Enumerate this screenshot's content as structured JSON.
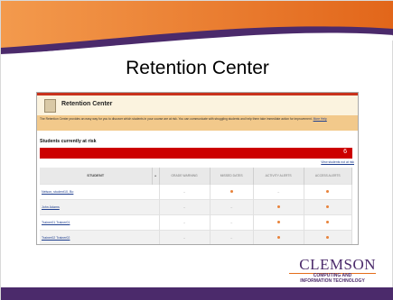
{
  "slide": {
    "title": "Retention Center",
    "colors": {
      "purple": "#4b2a6b",
      "orange": "#e46d1a",
      "red": "#cc0000"
    }
  },
  "screenshot": {
    "header_title": "Retention Center",
    "info_text": "The Retention Center provides an easy way for you to discover which students in your course are at risk. You can communicate with struggling students and help them take immediate action for improvement. ",
    "info_link": "More Help",
    "students_heading": "Students currently at risk",
    "at_risk_count": "6",
    "view_link": "View students not at risk",
    "columns": [
      "STUDENT",
      "GRADE WARNING",
      "MISSED DATES",
      "ACTIVITY ALERTS",
      "ACCESS ALERTS"
    ],
    "rows": [
      {
        "name": "Nelson, student10, Bo",
        "cells": [
          "–",
          "●",
          "–",
          "●"
        ]
      },
      {
        "name": "John Adams",
        "cells": [
          "–",
          "–",
          "●",
          "●"
        ]
      },
      {
        "name": "Trainer01 Trainer01",
        "cells": [
          "–",
          "–",
          "●",
          "●"
        ]
      },
      {
        "name": "Trainer02 Trainer02",
        "cells": [
          "–",
          "–",
          "●",
          "●"
        ]
      }
    ]
  },
  "logo": {
    "text": "CLEMSON",
    "line1": "COMPUTING AND",
    "line2": "INFORMATION TECHNOLOGY"
  }
}
